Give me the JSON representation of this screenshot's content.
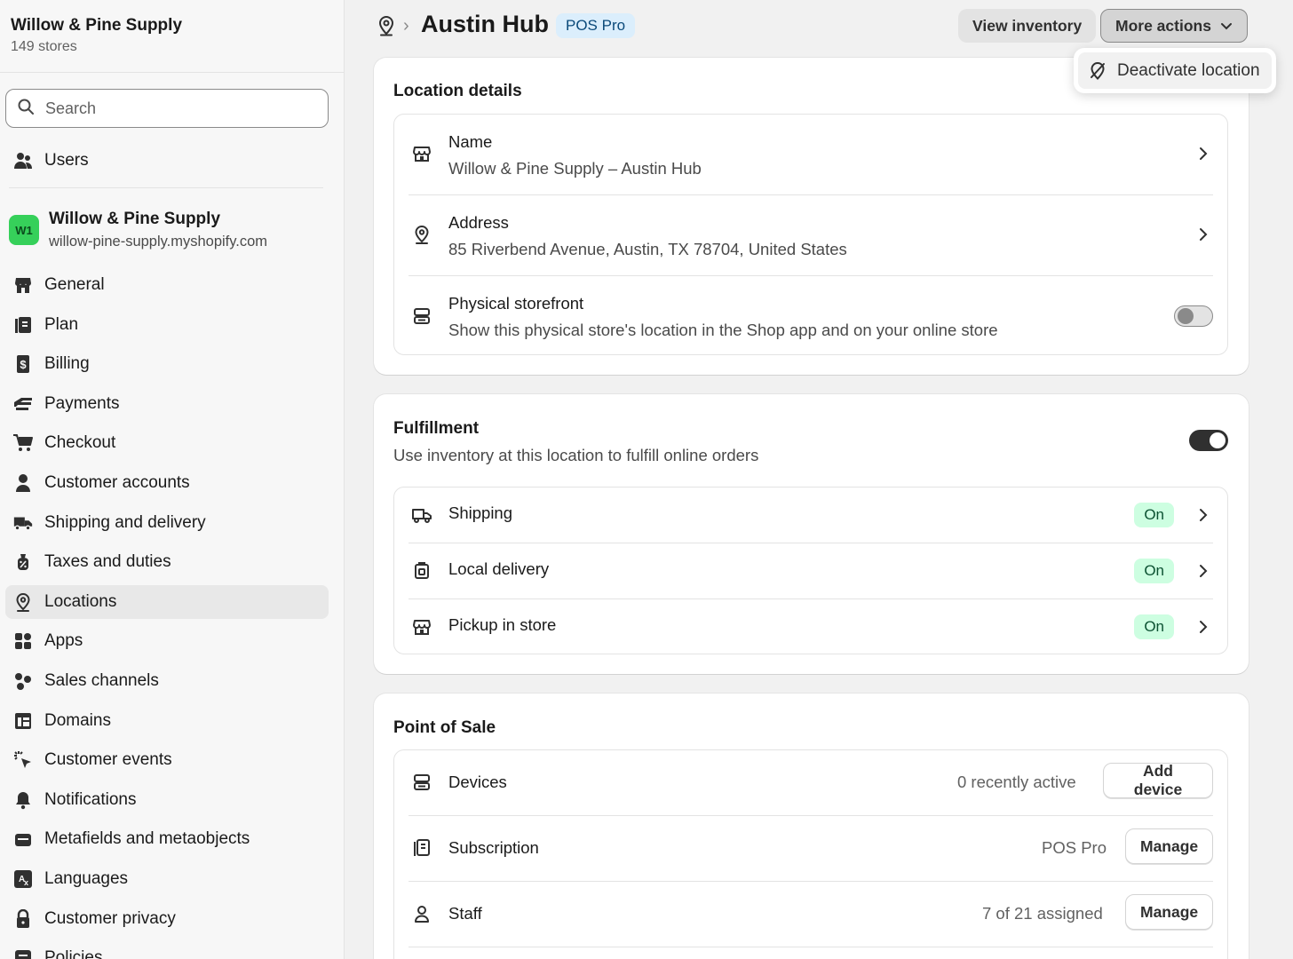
{
  "sidebar": {
    "store_name": "Willow & Pine Supply",
    "store_count": "149 stores",
    "search_placeholder": "Search",
    "users_label": "Users",
    "shop": {
      "avatar": "W1",
      "name": "Willow & Pine Supply",
      "domain": "willow-pine-supply.myshopify.com"
    },
    "items": [
      {
        "label": "General",
        "icon": "store-icon"
      },
      {
        "label": "Plan",
        "icon": "plan-icon"
      },
      {
        "label": "Billing",
        "icon": "billing-icon"
      },
      {
        "label": "Payments",
        "icon": "payments-icon"
      },
      {
        "label": "Checkout",
        "icon": "cart-icon"
      },
      {
        "label": "Customer accounts",
        "icon": "person-icon"
      },
      {
        "label": "Shipping and delivery",
        "icon": "truck-icon"
      },
      {
        "label": "Taxes and duties",
        "icon": "tax-icon"
      },
      {
        "label": "Locations",
        "icon": "location-pin-icon",
        "active": true
      },
      {
        "label": "Apps",
        "icon": "apps-icon"
      },
      {
        "label": "Sales channels",
        "icon": "channels-icon"
      },
      {
        "label": "Domains",
        "icon": "domains-icon"
      },
      {
        "label": "Customer events",
        "icon": "cursor-click-icon"
      },
      {
        "label": "Notifications",
        "icon": "bell-icon"
      },
      {
        "label": "Metafields and metaobjects",
        "icon": "metafields-icon"
      },
      {
        "label": "Languages",
        "icon": "translate-icon"
      },
      {
        "label": "Customer privacy",
        "icon": "lock-icon"
      },
      {
        "label": "Policies",
        "icon": "policies-icon"
      }
    ]
  },
  "header": {
    "title": "Austin Hub",
    "badge": "POS Pro",
    "view_inventory": "View inventory",
    "more_actions": "More actions",
    "dropdown_item": "Deactivate location"
  },
  "location_details": {
    "title": "Location details",
    "name_label": "Name",
    "name_value": "Willow & Pine Supply – Austin Hub",
    "address_label": "Address",
    "address_value": "85 Riverbend Avenue, Austin, TX 78704, United States",
    "storefront_label": "Physical storefront",
    "storefront_desc": "Show this physical store's location in the Shop app and on your online store",
    "storefront_enabled": false
  },
  "fulfillment": {
    "title": "Fulfillment",
    "desc": "Use inventory at this location to fulfill online orders",
    "enabled": true,
    "rows": [
      {
        "label": "Shipping",
        "status": "On"
      },
      {
        "label": "Local delivery",
        "status": "On"
      },
      {
        "label": "Pickup in store",
        "status": "On"
      }
    ]
  },
  "pos": {
    "title": "Point of Sale",
    "devices_label": "Devices",
    "devices_value": "0 recently active",
    "devices_button": "Add device",
    "subscription_label": "Subscription",
    "subscription_value": "POS Pro",
    "subscription_button": "Manage",
    "staff_label": "Staff",
    "staff_value": "7 of 21 assigned",
    "staff_button": "Manage"
  },
  "colors": {
    "accent_on": "#cdfee1",
    "toggle_on": "#303030",
    "avatar_green": "#36d05a",
    "badge_blue": "#dbeefc"
  }
}
